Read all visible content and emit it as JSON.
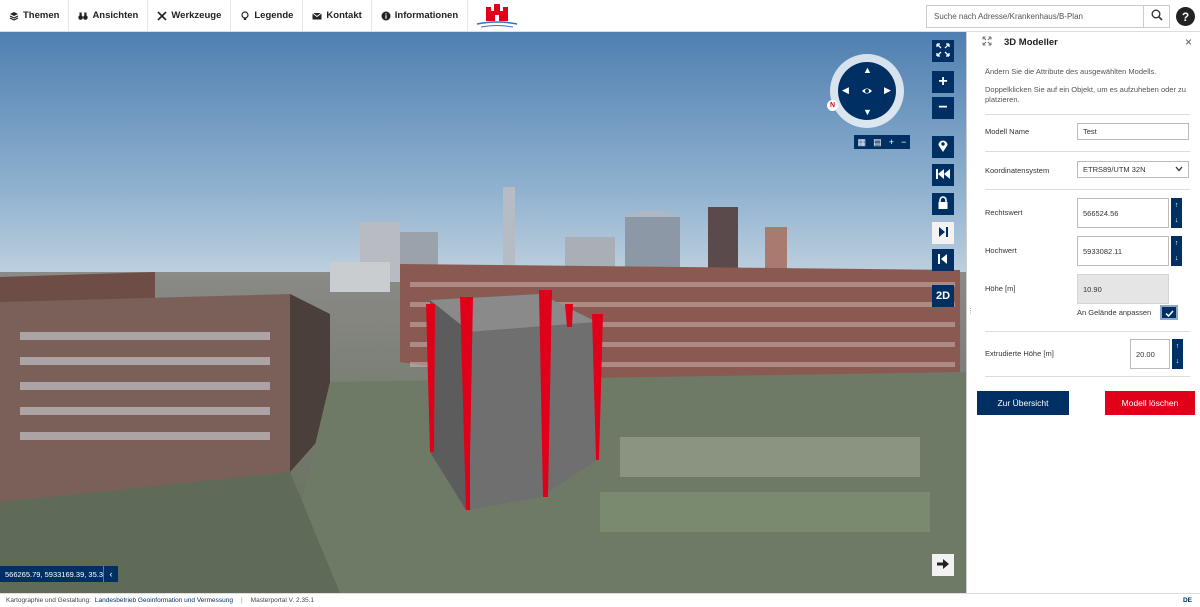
{
  "menu": {
    "items": [
      {
        "label": "Themen",
        "icon": "layers-icon"
      },
      {
        "label": "Ansichten",
        "icon": "binoculars-icon"
      },
      {
        "label": "Werkzeuge",
        "icon": "tools-icon"
      },
      {
        "label": "Legende",
        "icon": "lightbulb-icon"
      },
      {
        "label": "Kontakt",
        "icon": "envelope-icon"
      },
      {
        "label": "Informationen",
        "icon": "info-icon"
      }
    ]
  },
  "search": {
    "placeholder": "Suche nach Adresse/Krankenhaus/B-Plan"
  },
  "help": {
    "label": "?"
  },
  "map": {
    "compass_north": "N",
    "btn_2d": "2D",
    "coordinates": "566265.79, 5933169.39, 35.3"
  },
  "panel": {
    "title": "3D Modeller",
    "desc1": "Ändern Sie die Attribute des ausgewählten Modells.",
    "desc2": "Doppelklicken Sie auf ein Objekt, um es aufzuheben oder zu platzieren.",
    "model_name_label": "Modell Name",
    "model_name_value": "Test",
    "crs_label": "Koordinatensystem",
    "crs_value": "ETRS89/UTM 32N",
    "easting_label": "Rechtswert",
    "easting_value": "566524.56",
    "northing_label": "Hochwert",
    "northing_value": "5933082.11",
    "height_label": "Höhe [m]",
    "height_value": "10.90",
    "terrain_label": "An Gelände anpassen",
    "terrain_checked": true,
    "extrude_label": "Extrudierte Höhe [m]",
    "extrude_value": "20.00",
    "overview_button": "Zur Übersicht",
    "delete_button": "Modell löschen"
  },
  "footer": {
    "credit_label": "Kartographie und Gestaltung:",
    "credit_link": "Landesbetrieb Geoinformation und Vermessung",
    "sep": "|",
    "version": "Masterportal V. 2.35.1",
    "language": "DE"
  },
  "colors": {
    "navy": "#003063",
    "red": "#e10019"
  }
}
